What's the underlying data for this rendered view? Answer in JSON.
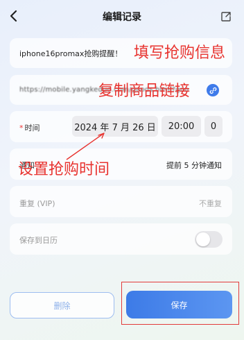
{
  "header": {
    "title": "编辑记录",
    "back_icon": "chevron-left-icon",
    "share_icon": "share-icon"
  },
  "form": {
    "product_name": {
      "value": "iphone16promax抢购提醒！"
    },
    "product_link": {
      "value": "https://mobile.yangkeduo.com/goods.html?goods_id=",
      "icon": "link-icon"
    },
    "time": {
      "label": "时间",
      "required_mark": "*",
      "date": "2024 年 7 月 26 日",
      "hour": "20:00",
      "minute": "0"
    },
    "notify": {
      "label": "通知",
      "value": "提前 5 分钟通知"
    },
    "repeat": {
      "label": "重复 (VIP)",
      "value": "不重复"
    },
    "calendar": {
      "label": "保存到日历",
      "enabled": false
    }
  },
  "buttons": {
    "delete": "删除",
    "save": "保存"
  },
  "annotations": {
    "fill_info": "填写抢购信息",
    "copy_link": "复制商品链接",
    "set_time": "设置抢购时间",
    "color": "#e8332f"
  },
  "colors": {
    "primary": "#3d7be7",
    "required": "#e33333",
    "highlight_border": "#e23a3a"
  }
}
